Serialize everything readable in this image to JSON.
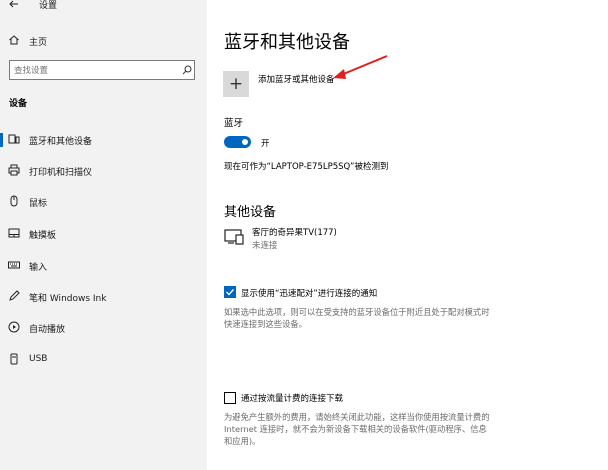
{
  "sidebar": {
    "window_title": "设置",
    "home_label": "主页",
    "search_placeholder": "查找设置",
    "section_label": "设备",
    "items": [
      {
        "label": "蓝牙和其他设备",
        "icon": "bluetooth-devices-icon"
      },
      {
        "label": "打印机和扫描仪",
        "icon": "printer-icon"
      },
      {
        "label": "鼠标",
        "icon": "mouse-icon"
      },
      {
        "label": "触摸板",
        "icon": "touchpad-icon"
      },
      {
        "label": "输入",
        "icon": "keyboard-icon"
      },
      {
        "label": "笔和 Windows Ink",
        "icon": "pen-icon"
      },
      {
        "label": "自动播放",
        "icon": "autoplay-icon"
      },
      {
        "label": "USB",
        "icon": "usb-icon"
      }
    ]
  },
  "main": {
    "page_title": "蓝牙和其他设备",
    "add_device_label": "添加蓝牙或其他设备",
    "bluetooth": {
      "heading": "蓝牙",
      "toggle_state": "开",
      "discoverable_text": "现在可作为“LAPTOP-E75LP5SQ”被检测到"
    },
    "other_devices": {
      "heading": "其他设备",
      "devices": [
        {
          "name": "客厅的奇异果TV(177)",
          "status": "未连接",
          "icon": "tv-display-icon"
        }
      ]
    },
    "swift_pair": {
      "label": "显示使用“迅速配对”进行连接的通知",
      "checked": true,
      "description_line1": "如果选中此选项，则可以在受支持的蓝牙设备位于附近且处于配对模式时",
      "description_line2": "快速连接到这些设备。"
    },
    "metered": {
      "label": "通过按流量计费的连接下载",
      "checked": false,
      "description_line1": "为避免产生额外的费用，请始终关闭此功能，这样当你使用按流量计费的",
      "description_line2": "Internet 连接时，就不会为新设备下载相关的设备软件(驱动程序、信息",
      "description_line3": "和应用)。"
    }
  },
  "colors": {
    "accent": "#0067c0",
    "sidebar_bg": "#f2f2f2",
    "annotation_arrow": "#e0201c"
  }
}
